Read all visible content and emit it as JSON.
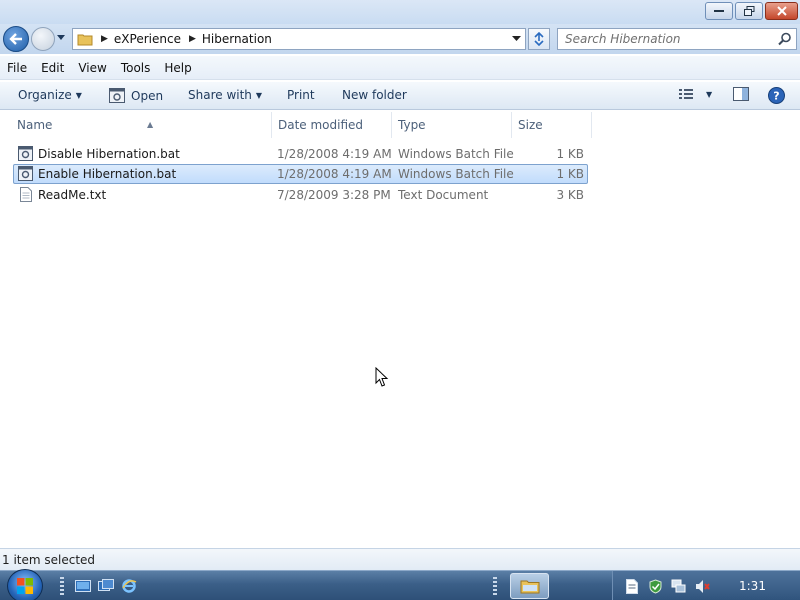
{
  "window": {
    "buttons": {
      "minimize": "minimize",
      "maximize": "maximize",
      "close": "close"
    }
  },
  "address": {
    "breadcrumbs": [
      "eXPerience",
      "Hibernation"
    ]
  },
  "search": {
    "placeholder": "Search Hibernation"
  },
  "menu": {
    "items": [
      "File",
      "Edit",
      "View",
      "Tools",
      "Help"
    ]
  },
  "toolbar": {
    "organize": "Organize",
    "open": "Open",
    "share_with": "Share with",
    "print": "Print",
    "new_folder": "New folder"
  },
  "columns": {
    "name": "Name",
    "date_modified": "Date modified",
    "type": "Type",
    "size": "Size"
  },
  "files": [
    {
      "name": "Disable Hibernation.bat",
      "date": "1/28/2008 4:19 AM",
      "type": "Windows Batch File",
      "size": "1 KB",
      "icon": "batch-file-icon",
      "selected": false
    },
    {
      "name": "Enable Hibernation.bat",
      "date": "1/28/2008 4:19 AM",
      "type": "Windows Batch File",
      "size": "1 KB",
      "icon": "batch-file-icon",
      "selected": true
    },
    {
      "name": "ReadMe.txt",
      "date": "7/28/2009 3:28 PM",
      "type": "Text Document",
      "size": "3 KB",
      "icon": "text-file-icon",
      "selected": false
    }
  ],
  "status": {
    "text": "1 item selected"
  },
  "taskbar": {
    "clock": "1:31"
  },
  "colors": {
    "selection": "#c1dcfc",
    "selection_border": "#7da2ce",
    "taskbar": "#3b5f88",
    "command_text": "#1e395b"
  }
}
